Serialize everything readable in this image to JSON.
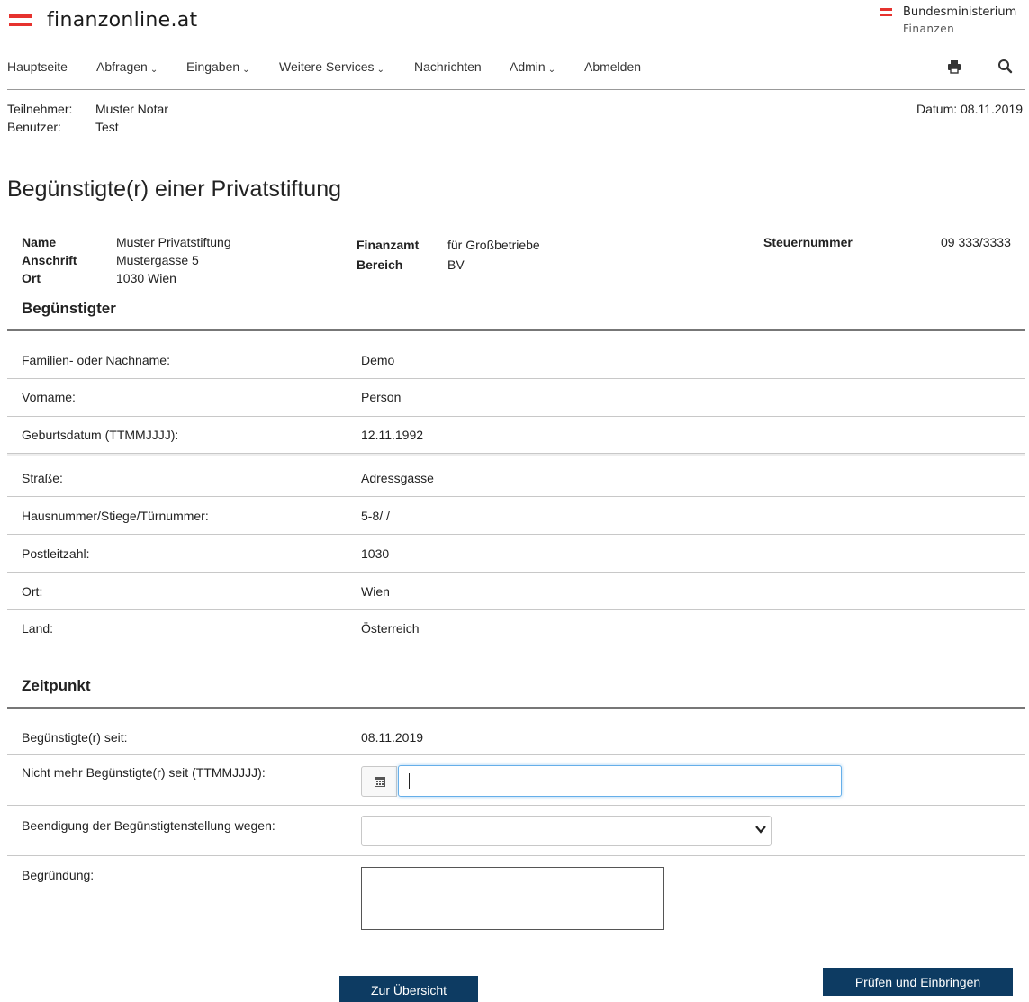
{
  "header": {
    "logo_text": "finanzonline.at",
    "ministry_line1": "Bundesministerium",
    "ministry_line2": "Finanzen",
    "brand_color": "#e6322e"
  },
  "nav": {
    "items": [
      {
        "label": "Hauptseite"
      },
      {
        "label": "Abfragen"
      },
      {
        "label": "Eingaben"
      },
      {
        "label": "Weitere Services"
      },
      {
        "label": "Nachrichten"
      },
      {
        "label": "Admin"
      },
      {
        "label": "Abmelden"
      }
    ],
    "print_icon": "printer-icon",
    "search_icon": "search-icon"
  },
  "session": {
    "teilnehmer_label": "Teilnehmer:",
    "teilnehmer_value": "Muster Notar",
    "benutzer_label": "Benutzer:",
    "benutzer_value": "Test",
    "datum": "Datum: 08.11.2019"
  },
  "page_title": "Begünstigte(r) einer Privatstiftung",
  "stiftung": {
    "name_label": "Name",
    "name_value": "Muster Privatstiftung",
    "anschrift_label": "Anschrift",
    "anschrift_value": "Mustergasse 5",
    "ort_label": "Ort",
    "ort_value": "1030 Wien",
    "finanzamt_label": "Finanzamt",
    "finanzamt_value": "für Großbetriebe",
    "bereich_label": "Bereich",
    "bereich_value": "BV",
    "steuernummer_label": "Steuernummer",
    "steuernummer_value": "09 333/3333"
  },
  "beguenstigter": {
    "section_title": "Begünstigter",
    "rows": [
      {
        "label": "Familien- oder Nachname:",
        "value": "Demo"
      },
      {
        "label": "Vorname:",
        "value": "Person"
      },
      {
        "label": "Geburtsdatum (TTMMJJJJ):",
        "value": "12.11.1992"
      },
      {
        "label": "Straße:",
        "value": "Adressgasse"
      },
      {
        "label": "Hausnummer/Stiege/Türnummer:",
        "value": "5-8/ /"
      },
      {
        "label": "Postleitzahl:",
        "value": "1030"
      },
      {
        "label": "Ort:",
        "value": "Wien"
      },
      {
        "label": "Land:",
        "value": "Österreich"
      }
    ]
  },
  "zeitpunkt": {
    "section_title": "Zeitpunkt",
    "seit_label": "Begünstigte(r) seit:",
    "seit_value": "08.11.2019",
    "nicht_mehr_label": "Nicht mehr Begünstigte(r) seit (TTMMJJJJ):",
    "nicht_mehr_value": "",
    "beendigung_label": "Beendigung der Begünstigtenstellung wegen:",
    "beendigung_selected": "",
    "begruendung_label": "Begründung:",
    "begruendung_value": ""
  },
  "buttons": {
    "overview": "Zur Übersicht",
    "submit": "Prüfen und Einbringen",
    "color": "#0d3b62"
  }
}
